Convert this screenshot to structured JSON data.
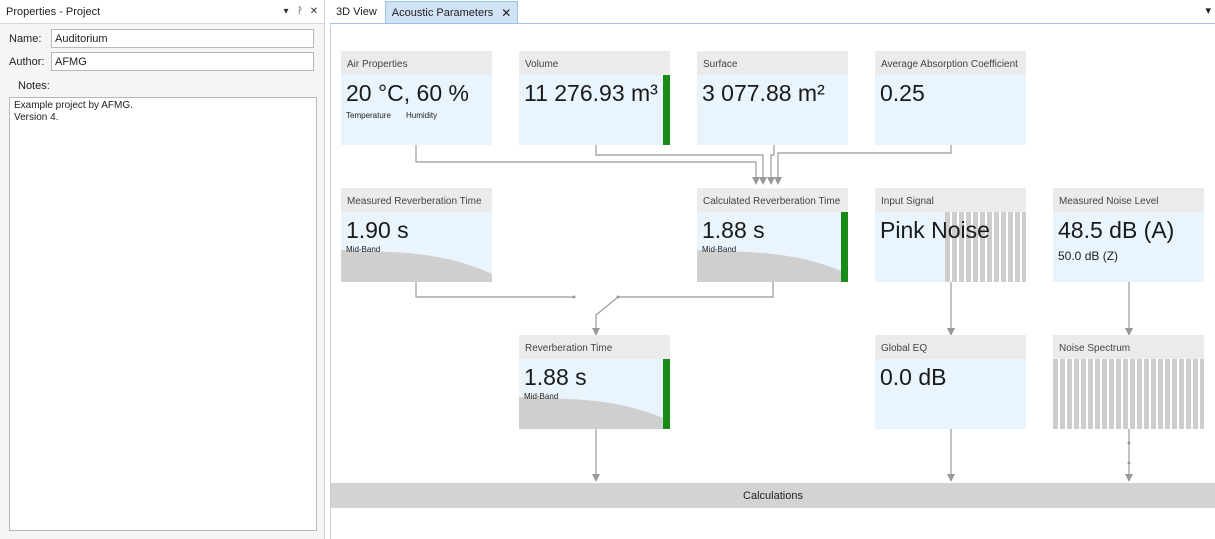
{
  "properties_panel": {
    "title": "Properties - Project",
    "name_label": "Name:",
    "name_value": "Auditorium",
    "author_label": "Author:",
    "author_value": "AFMG",
    "notes_label": "Notes:",
    "notes_value": "Example project by AFMG.\nVersion 4."
  },
  "tabs": [
    {
      "label": "3D View",
      "active": false
    },
    {
      "label": "Acoustic Parameters",
      "active": true
    }
  ],
  "blocks": {
    "air": {
      "title": "Air Properties",
      "value": "20 °C,  60 %",
      "sub1": "Temperature",
      "sub2": "Humidity"
    },
    "volume": {
      "title": "Volume",
      "value": "11 276.93 m³"
    },
    "surface": {
      "title": "Surface",
      "value": "3 077.88 m²"
    },
    "absorption": {
      "title": "Average Absorption Coefficient",
      "value": "0.25"
    },
    "measured_rt": {
      "title": "Measured Reverberation Time",
      "value": "1.90  s",
      "sub": "Mid-Band"
    },
    "calculated_rt": {
      "title": "Calculated Reverberation Time",
      "value": "1.88  s",
      "sub": "Mid-Band"
    },
    "input_signal": {
      "title": "Input Signal",
      "value": "Pink Noise"
    },
    "measured_noise": {
      "title": "Measured Noise Level",
      "value": "48.5  dB (A)",
      "sub": "50.0  dB (Z)"
    },
    "reverb_time": {
      "title": "Reverberation Time",
      "value": "1.88  s",
      "sub": "Mid-Band"
    },
    "global_eq": {
      "title": "Global EQ",
      "value": "0.0  dB"
    },
    "noise_spectrum": {
      "title": "Noise Spectrum"
    }
  },
  "calculations_label": "Calculations",
  "colors": {
    "status_green": "#178a17",
    "block_body": "#eaf4fd",
    "block_header": "#ebebeb",
    "tab_active": "#cfe2f6"
  }
}
